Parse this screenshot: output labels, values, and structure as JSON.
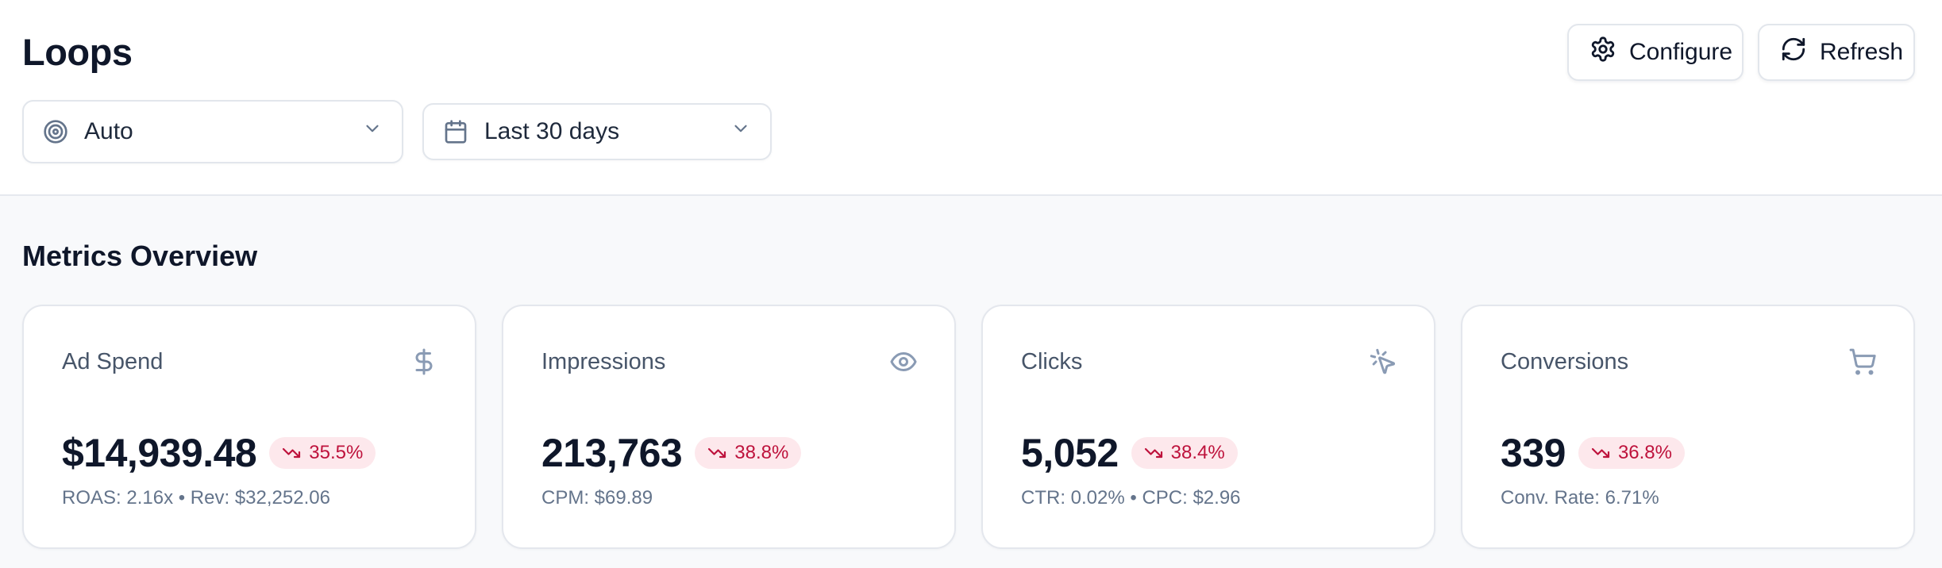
{
  "header": {
    "title": "Loops",
    "configure_label": "Configure",
    "refresh_label": "Refresh"
  },
  "filters": {
    "mode": {
      "value": "Auto",
      "icon": "target-icon"
    },
    "date_range": {
      "value": "Last 30 days",
      "icon": "calendar-icon"
    }
  },
  "metrics": {
    "section_title": "Metrics Overview",
    "cards": [
      {
        "name": "Ad Spend",
        "icon": "dollar-icon",
        "value": "$14,939.48",
        "change": "35.5%",
        "trend": "down",
        "sub": "ROAS: 2.16x • Rev: $32,252.06"
      },
      {
        "name": "Impressions",
        "icon": "eye-icon",
        "value": "213,763",
        "change": "38.8%",
        "trend": "down",
        "sub": "CPM: $69.89"
      },
      {
        "name": "Clicks",
        "icon": "pointer-click-icon",
        "value": "5,052",
        "change": "38.4%",
        "trend": "down",
        "sub": "CTR: 0.02% • CPC: $2.96"
      },
      {
        "name": "Conversions",
        "icon": "cart-icon",
        "value": "339",
        "change": "36.8%",
        "trend": "down",
        "sub": "Conv. Rate: 6.71%"
      }
    ]
  },
  "colors": {
    "negative_badge_bg": "#fde8ec",
    "negative_badge_text": "#be123c",
    "icon_muted": "#8a9bb4"
  }
}
